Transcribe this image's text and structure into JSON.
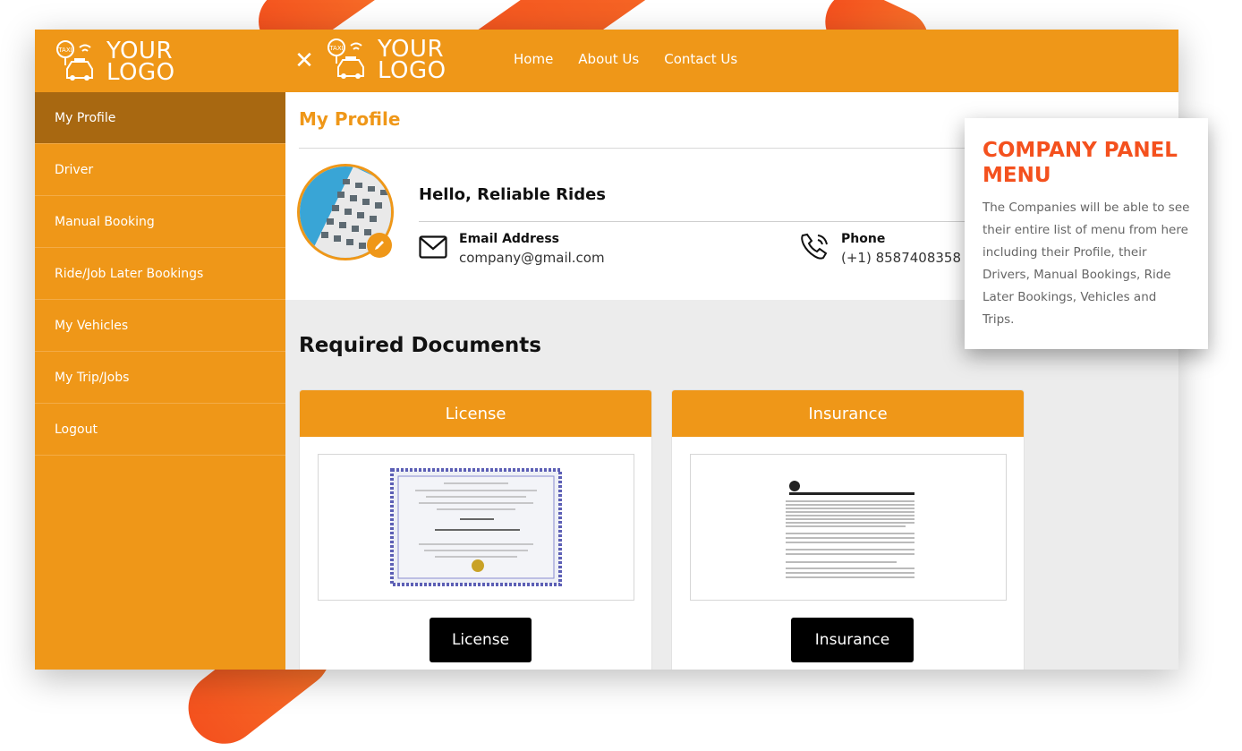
{
  "brand": {
    "logo_line1": "YOUR",
    "logo_line2": "LOGO",
    "logo_badge": "TAXI",
    "accent_color": "#ef9718",
    "highlight_color": "#f4511e"
  },
  "topnav": {
    "close_icon": "close-icon",
    "items": [
      "Home",
      "About Us",
      "Contact Us"
    ]
  },
  "sidebar": {
    "items": [
      {
        "label": "My Profile",
        "active": true
      },
      {
        "label": "Driver"
      },
      {
        "label": "Manual Booking"
      },
      {
        "label": "Ride/Job Later Bookings"
      },
      {
        "label": "My Vehicles"
      },
      {
        "label": "My Trip/Jobs"
      },
      {
        "label": "Logout"
      }
    ]
  },
  "profile": {
    "title": "My Profile",
    "greeting": "Hello, Reliable Rides",
    "email_label": "Email Address",
    "email_value": "company@gmail.com",
    "phone_label": "Phone",
    "phone_value": "(+1) 8587408358"
  },
  "documents": {
    "title": "Required Documents",
    "cards": [
      {
        "header": "License",
        "button": "License"
      },
      {
        "header": "Insurance",
        "button": "Insurance"
      }
    ]
  },
  "tooltip": {
    "title": "COMPANY PANEL MENU",
    "body": "The Companies will be able to see their entire list of menu from here including their Profile, their Drivers, Manual Bookings, Ride Later Bookings, Vehicles and Trips."
  }
}
